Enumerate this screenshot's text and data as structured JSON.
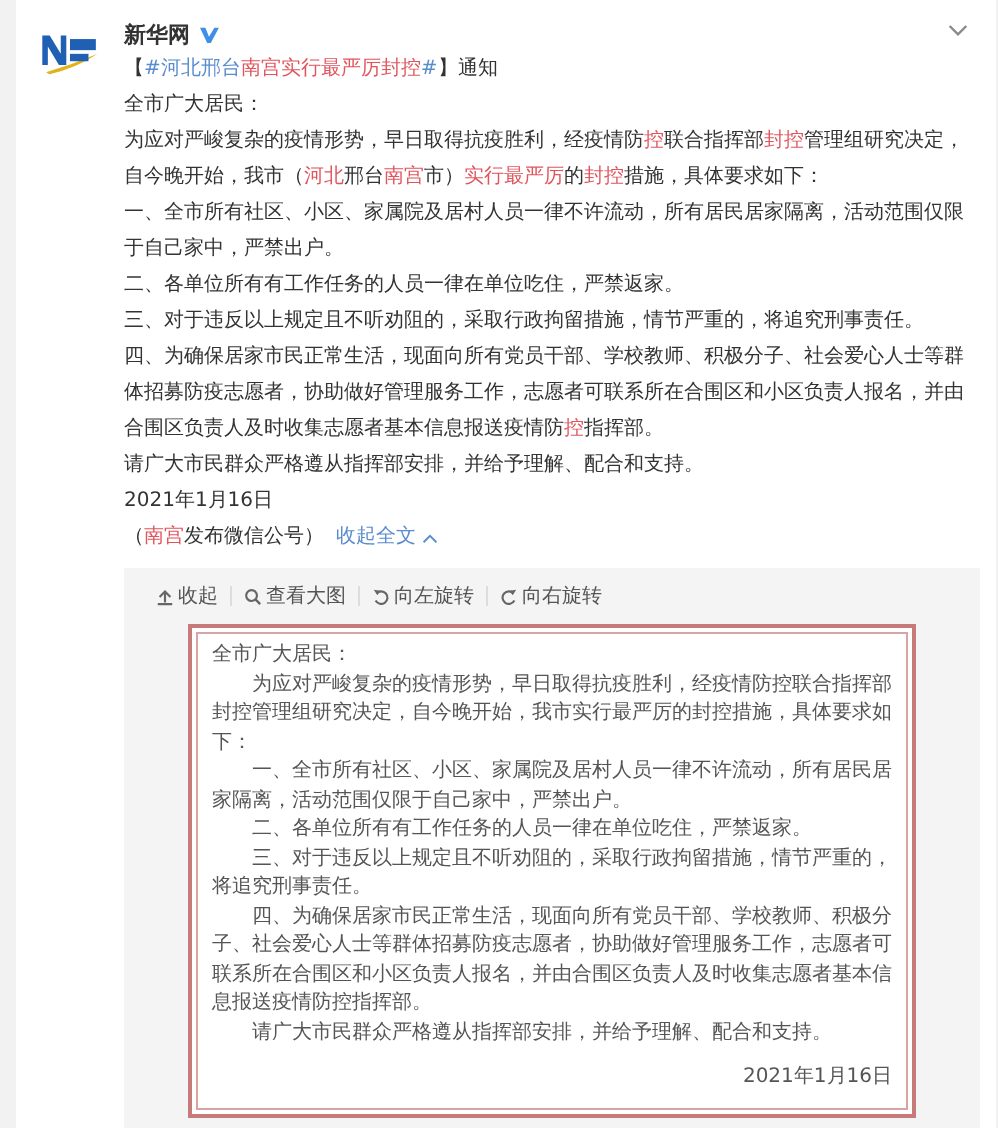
{
  "account": {
    "name": "新华网",
    "verified": true
  },
  "post": {
    "paragraphs": [
      [
        {
          "kind": "plain",
          "text": "【"
        },
        {
          "kind": "hashtag",
          "parts": [
            {
              "kind": "link",
              "text": "#河北邢台"
            },
            {
              "kind": "keyword",
              "text": "南宫实行最严厉封控"
            },
            {
              "kind": "link",
              "text": "#"
            }
          ]
        },
        {
          "kind": "plain",
          "text": "】通知"
        }
      ],
      [
        {
          "kind": "plain",
          "text": "全市广大居民："
        }
      ],
      [
        {
          "kind": "plain",
          "text": "为应对严峻复杂的疫情形势，早日取得抗疫胜利，经疫情防"
        },
        {
          "kind": "keyword",
          "text": "控"
        },
        {
          "kind": "plain",
          "text": "联合指挥部"
        },
        {
          "kind": "keyword",
          "text": "封控"
        },
        {
          "kind": "plain",
          "text": "管理组研究决定，自今晚开始，我市（"
        },
        {
          "kind": "keyword",
          "text": "河北"
        },
        {
          "kind": "plain",
          "text": "邢台"
        },
        {
          "kind": "keyword",
          "text": "南宫"
        },
        {
          "kind": "plain",
          "text": "市）"
        },
        {
          "kind": "keyword",
          "text": "实行最严厉"
        },
        {
          "kind": "plain",
          "text": "的"
        },
        {
          "kind": "keyword",
          "text": "封控"
        },
        {
          "kind": "plain",
          "text": "措施，具体要求如下："
        }
      ],
      [
        {
          "kind": "plain",
          "text": "一、全市所有社区、小区、家属院及居村人员一律不许流动，所有居民居家隔离，活动范围仅限于自己家中，严禁出户。"
        }
      ],
      [
        {
          "kind": "plain",
          "text": "二、各单位所有有工作任务的人员一律在单位吃住，严禁返家。"
        }
      ],
      [
        {
          "kind": "plain",
          "text": "三、对于违反以上规定且不听劝阻的，采取行政拘留措施，情节严重的，将追究刑事责任。"
        }
      ],
      [
        {
          "kind": "plain",
          "text": "四、为确保居家市民正常生活，现面向所有党员干部、学校教师、积极分子、社会爱心人士等群体招募防疫志愿者，协助做好管理服务工作，志愿者可联系所在合围区和小区负责人报名，并由合围区负责人及时收集志愿者基本信息报送疫情防"
        },
        {
          "kind": "keyword",
          "text": "控"
        },
        {
          "kind": "plain",
          "text": "指挥部。"
        }
      ],
      [
        {
          "kind": "plain",
          "text": "请广大市民群众严格遵从指挥部安排，并给予理解、配合和支持。"
        }
      ],
      [
        {
          "kind": "plain",
          "text": "2021年1月16日"
        }
      ]
    ],
    "source": [
      {
        "kind": "plain",
        "text": "（"
      },
      {
        "kind": "keyword",
        "text": "南宫"
      },
      {
        "kind": "plain",
        "text": "发布微信公号）"
      }
    ],
    "collapse_link": "收起全文"
  },
  "image_toolbar": [
    {
      "kind": "collapse",
      "label": "收起"
    },
    {
      "kind": "zoom",
      "label": "查看大图"
    },
    {
      "kind": "rotate-left",
      "label": "向左旋转"
    },
    {
      "kind": "rotate-right",
      "label": "向右旋转"
    }
  ],
  "image_document": {
    "salutation": "全市广大居民：",
    "paragraphs": [
      "为应对严峻复杂的疫情形势，早日取得抗疫胜利，经疫情防控联合指挥部封控管理组研究决定，自今晚开始，我市实行最严厉的封控措施，具体要求如下：",
      "一、全市所有社区、小区、家属院及居村人员一律不许流动，所有居民居家隔离，活动范围仅限于自己家中，严禁出户。",
      "二、各单位所有有工作任务的人员一律在单位吃住，严禁返家。",
      "三、对于违反以上规定且不听劝阻的，采取行政拘留措施，情节严重的，将追究刑事责任。",
      "四、为确保居家市民正常生活，现面向所有党员干部、学校教师、积极分子、社会爱心人士等群体招募防疫志愿者，协助做好管理服务工作，志愿者可联系所在合围区和小区负责人报名，并由合围区负责人及时收集志愿者基本信息报送疫情防控指挥部。",
      "请广大市民群众严格遵从指挥部安排，并给予理解、配合和支持。"
    ],
    "date": "2021年1月16日"
  }
}
